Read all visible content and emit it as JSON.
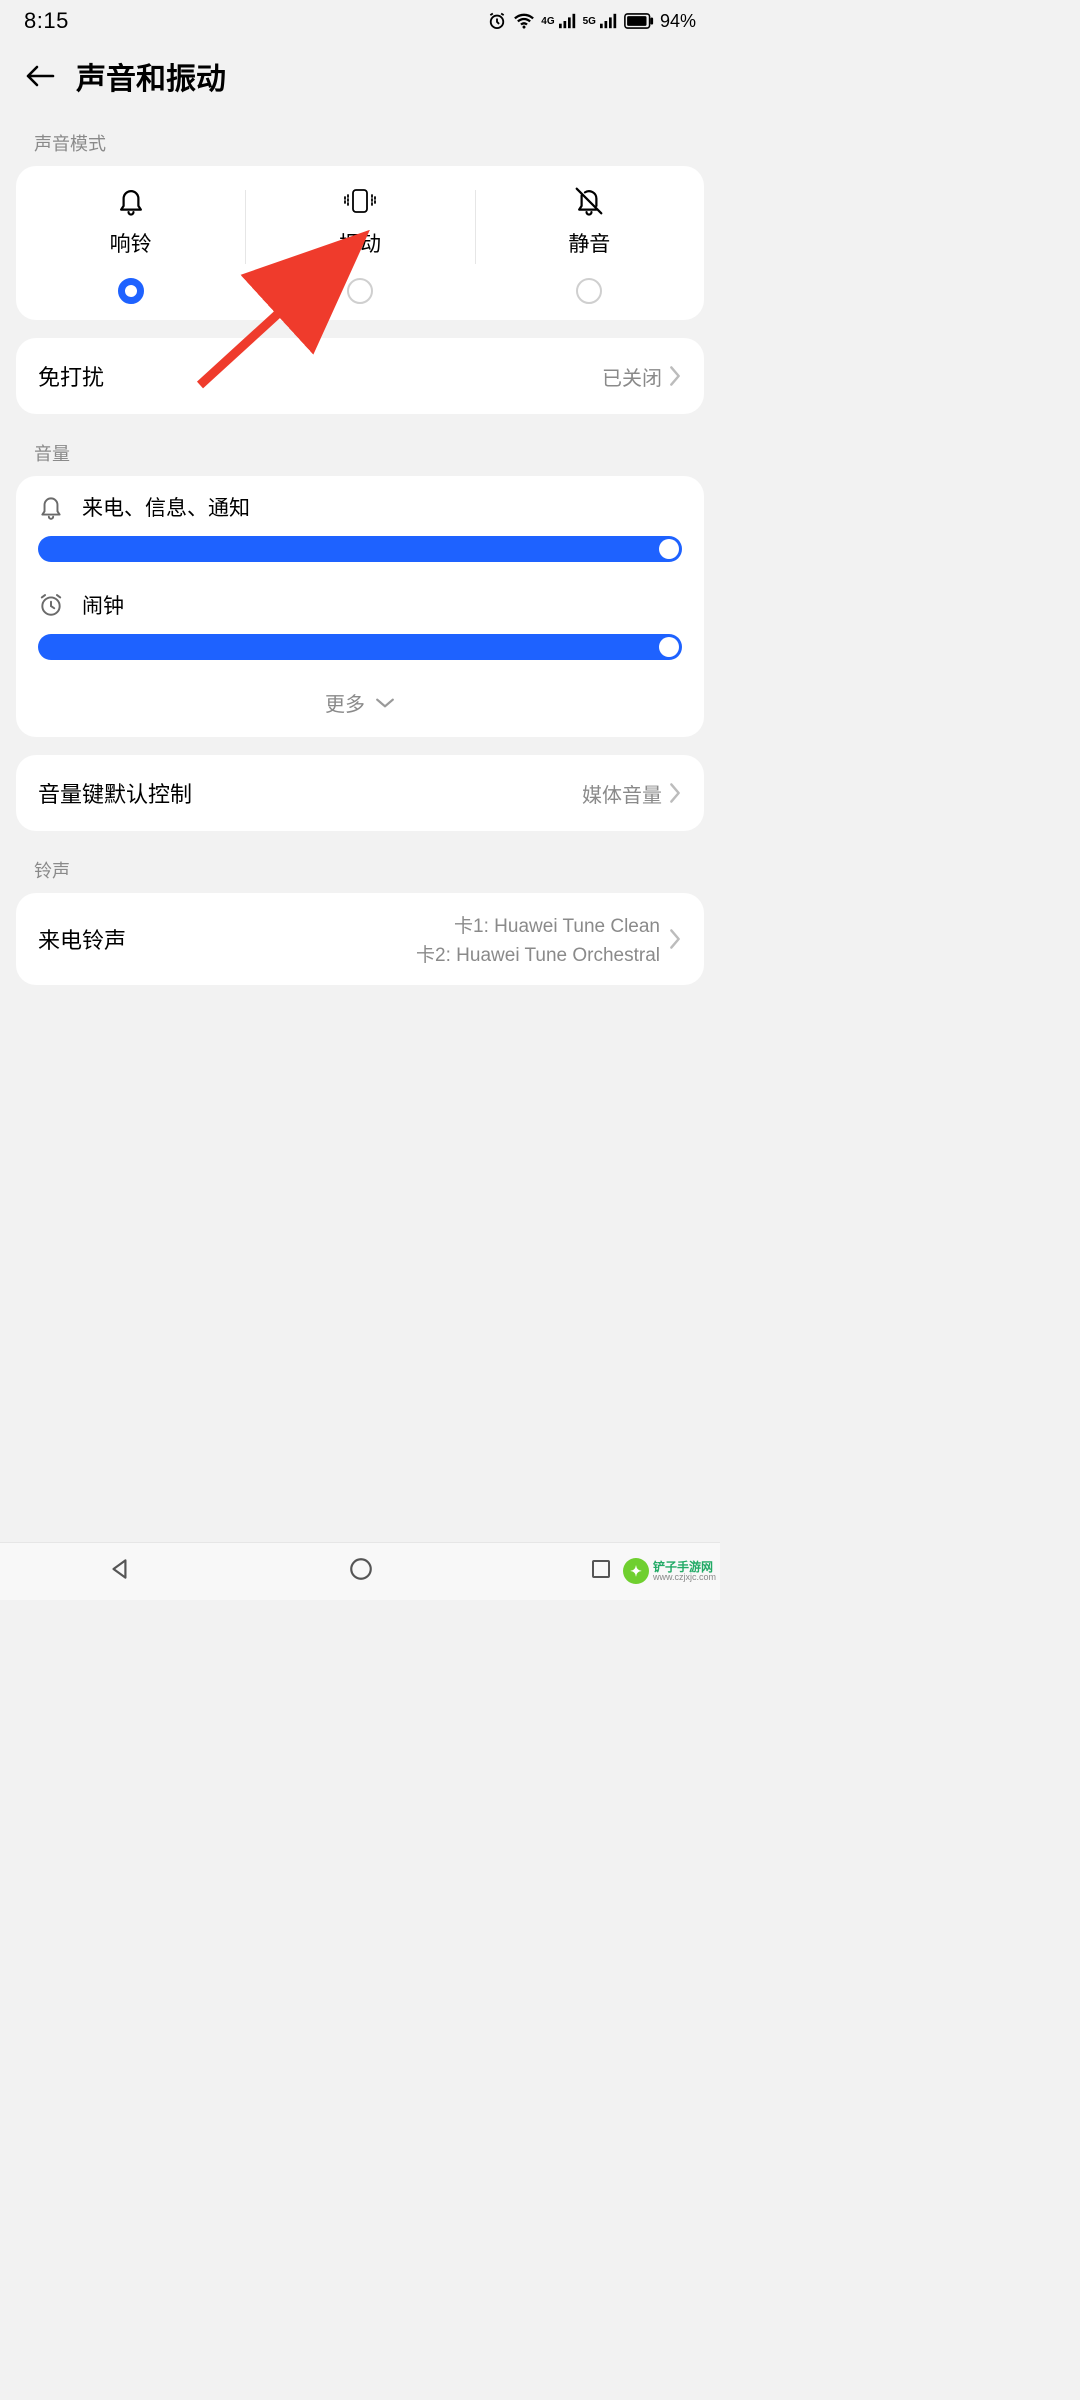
{
  "status": {
    "time": "8:15",
    "battery_text": "94%"
  },
  "header": {
    "title": "声音和振动"
  },
  "sections": {
    "sound_mode_label": "声音模式",
    "volume_label": "音量",
    "ringtone_label": "铃声"
  },
  "modes": {
    "ring": "响铃",
    "vibrate": "振动",
    "silent": "静音",
    "selected": "ring"
  },
  "dnd": {
    "title": "免打扰",
    "value": "已关闭"
  },
  "volume": {
    "calls_label": "来电、信息、通知",
    "alarm_label": "闹钟",
    "more_label": "更多"
  },
  "vol_button": {
    "title": "音量键默认控制",
    "value": "媒体音量"
  },
  "ringtone": {
    "title": "来电铃声",
    "line1": "卡1: Huawei Tune Clean",
    "line2": "卡2: Huawei Tune Orchestral"
  },
  "watermark": {
    "name": "铲子手游网",
    "url": "www.czjxjc.com"
  },
  "colors": {
    "accent": "#1e62ff",
    "arrow": "#ef3b2c"
  }
}
